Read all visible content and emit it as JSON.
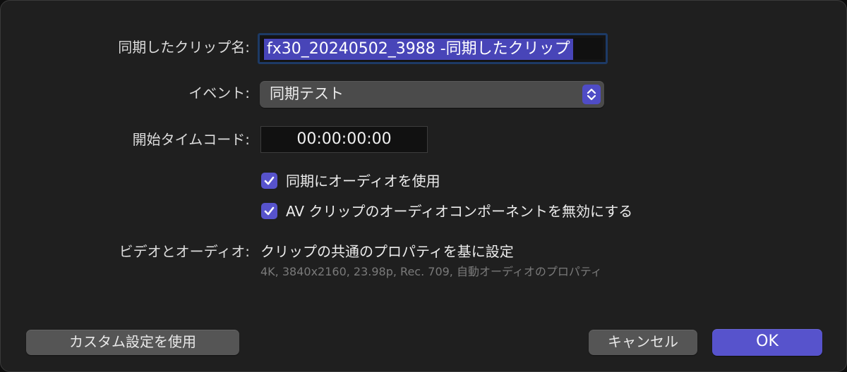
{
  "form": {
    "clip_name_label": "同期したクリップ名:",
    "clip_name_value": "fx30_20240502_3988 -同期したクリップ",
    "event_label": "イベント:",
    "event_value": "同期テスト",
    "timecode_label": "開始タイムコード:",
    "timecode_value": "00:00:00:00",
    "use_audio_for_sync_label": "同期にオーディオを使用",
    "use_audio_for_sync_checked": true,
    "disable_av_audio_label": "AV クリップのオーディオコンポーネントを無効にする",
    "disable_av_audio_checked": true,
    "video_audio_label": "ビデオとオーディオ:",
    "video_audio_value": "クリップの共通のプロパティを基に設定",
    "video_audio_detail": "4K, 3840x2160, 23.98p, Rec. 709, 自動オーディオのプロパティ"
  },
  "buttons": {
    "custom_settings": "カスタム設定を使用",
    "cancel": "キャンセル",
    "ok": "OK"
  },
  "colors": {
    "accent": "#5753cc",
    "selection": "#4845b8",
    "dialog_bg": "#1f1f1f"
  }
}
